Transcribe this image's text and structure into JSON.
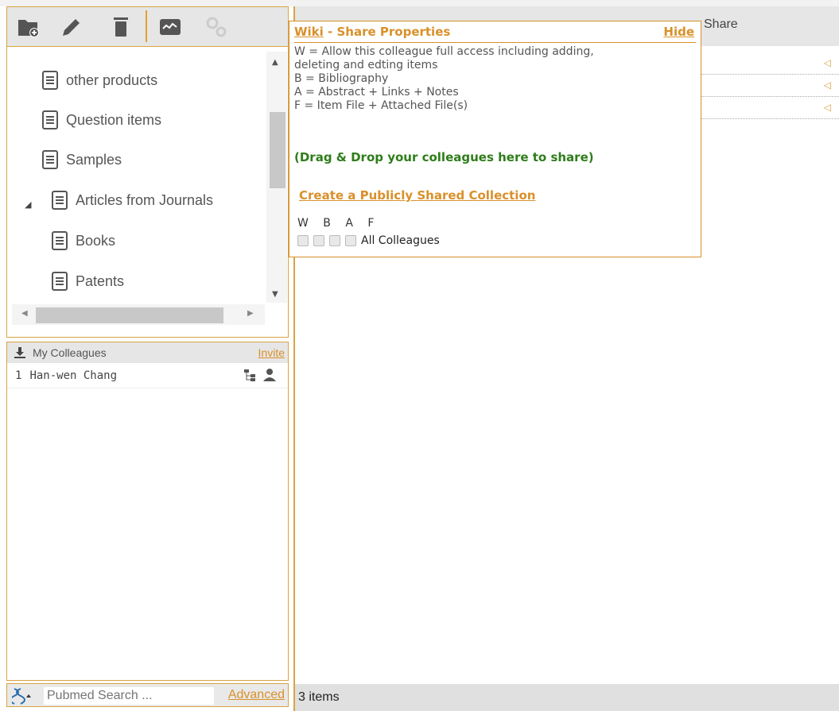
{
  "tree": {
    "items": [
      {
        "label": "other products"
      },
      {
        "label": "Question items"
      },
      {
        "label": "Samples"
      },
      {
        "label": "Articles from Journals"
      },
      {
        "label": "Books"
      },
      {
        "label": "Patents"
      }
    ]
  },
  "colleagues": {
    "header": "My Colleagues",
    "invite": "Invite",
    "rows": [
      {
        "index": "1",
        "name": "Han-wen Chang"
      }
    ]
  },
  "search": {
    "placeholder": "Pubmed Search ...",
    "advanced": "Advanced"
  },
  "main": {
    "share_column": "Share",
    "status": "3 items"
  },
  "popup": {
    "wiki": "Wiki",
    "title_rest": " - Share Properties",
    "hide": "Hide",
    "line1": "W = Allow this colleague full access including adding,",
    "line2": "deleting and edting items",
    "line3": "B = Bibliography",
    "line4": "A = Abstract + Links + Notes",
    "line5": "F = Item File + Attached File(s)",
    "drag_hint": "(Drag & Drop your colleagues here to share)",
    "create_public": "Create a Publicly Shared Collection",
    "col_w": "W",
    "col_b": "B",
    "col_a": "A",
    "col_f": "F",
    "all_colleagues": "All Colleagues"
  },
  "colors": {
    "accent": "#d9902a",
    "green": "#2e7d1a"
  }
}
